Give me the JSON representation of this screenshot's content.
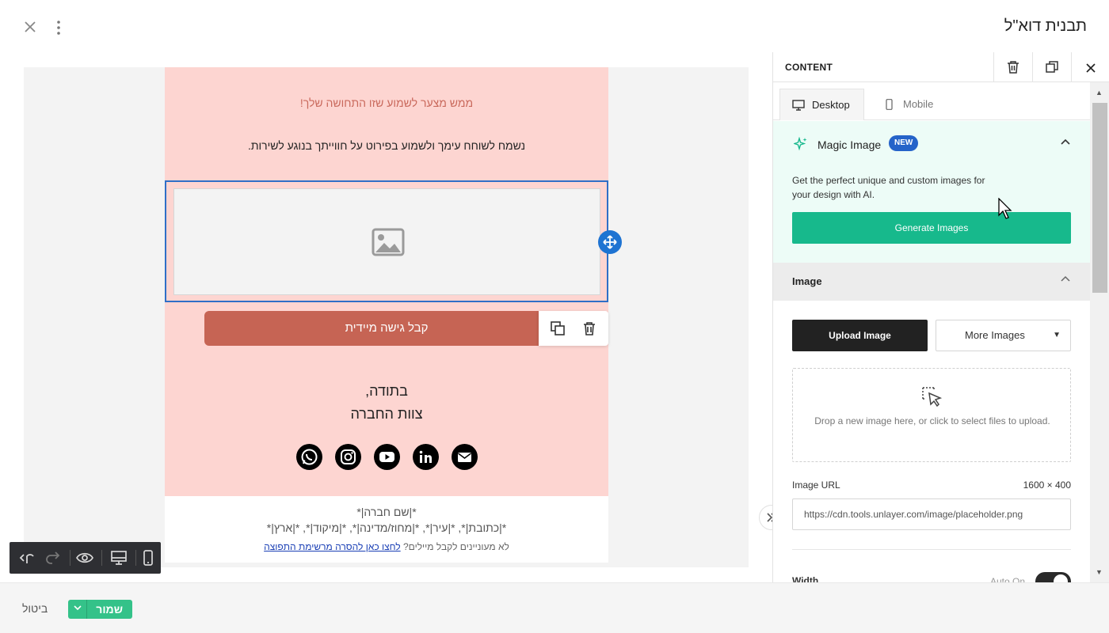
{
  "window": {
    "title": "תבנית דוא\"ל"
  },
  "email": {
    "headline": "ממש מצער לשמוע שזו התחושה שלך!",
    "subtext": "נשמח לשוחח עימך ולשמוע בפירוט על חווייתך בנוגע לשירות.",
    "cta_label": "קבל גישה מיידית",
    "signoff_line1": "בתודה,",
    "signoff_line2": "צוות החברה",
    "social_icons": [
      "email-icon",
      "linkedin-icon",
      "youtube-icon",
      "instagram-icon",
      "whatsapp-icon"
    ],
    "footer_line1": "*|שם חברה|*",
    "footer_line2": "*|כתובת|*, *|עיר|*, *|מחוז/מדינה|*, *|מיקוד|*, *|ארץ|*",
    "footer_unsub_text": "לא מעוניינים לקבל מיילים?",
    "footer_unsub_link": "לחצו כאן להסרה מרשימת התפוצה",
    "colors": {
      "background": "#fdd5d1",
      "headline": "#c9695c",
      "button": "#c66454"
    }
  },
  "panel": {
    "title": "CONTENT",
    "tabs": [
      {
        "label": "Desktop",
        "active": true
      },
      {
        "label": "Mobile",
        "active": false
      }
    ],
    "magic_image": {
      "title": "Magic Image",
      "badge": "NEW",
      "description": "Get the perfect unique and custom images for your design with AI.",
      "button": "Generate Images"
    },
    "image_section": {
      "title": "Image",
      "upload_button": "Upload Image",
      "more_button": "More Images",
      "dropzone_text": "Drop a new image here, or click to select files to upload.",
      "url_label": "Image URL",
      "size": "1600 × 400",
      "url_value": "https://cdn.tools.unlayer.com/image/placeholder.png",
      "width_label": "Width",
      "auto_label": "Auto On"
    }
  },
  "footer_bar": {
    "save_label": "שמור",
    "cancel_label": "ביטול"
  },
  "colors": {
    "accent_green": "#17b98c",
    "save_green": "#34c289",
    "selection_blue": "#2f6fc7",
    "badge_blue": "#2563c9"
  }
}
